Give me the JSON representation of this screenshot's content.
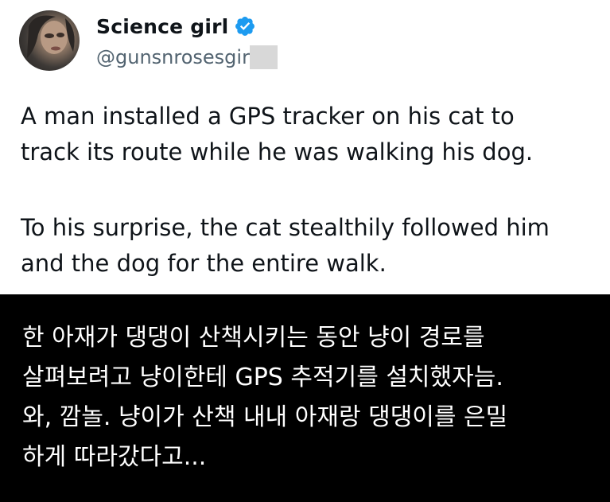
{
  "tweet": {
    "display_name": "Science girl",
    "handle": "@gunsnrosesgir",
    "avatar_icon": "profile-photo",
    "verified_icon": "verified-badge-icon",
    "verified_color": "#1d9bf0",
    "lines": [
      "A man installed a GPS tracker on his cat to",
      "track its route while he was walking his dog.",
      "To his surprise, the cat stealthily followed him",
      "and the dog for the entire walk."
    ]
  },
  "caption": {
    "lines": [
      "한 아재가 댕댕이 산책시키는 동안 냥이 경로를",
      "살펴보려고 냥이한테 GPS 추적기를 설치했자늠.",
      "와, 깜놀. 냥이가 산책 내내 아재랑 댕댕이를 은밀",
      "하게 따라갔다고..."
    ]
  }
}
